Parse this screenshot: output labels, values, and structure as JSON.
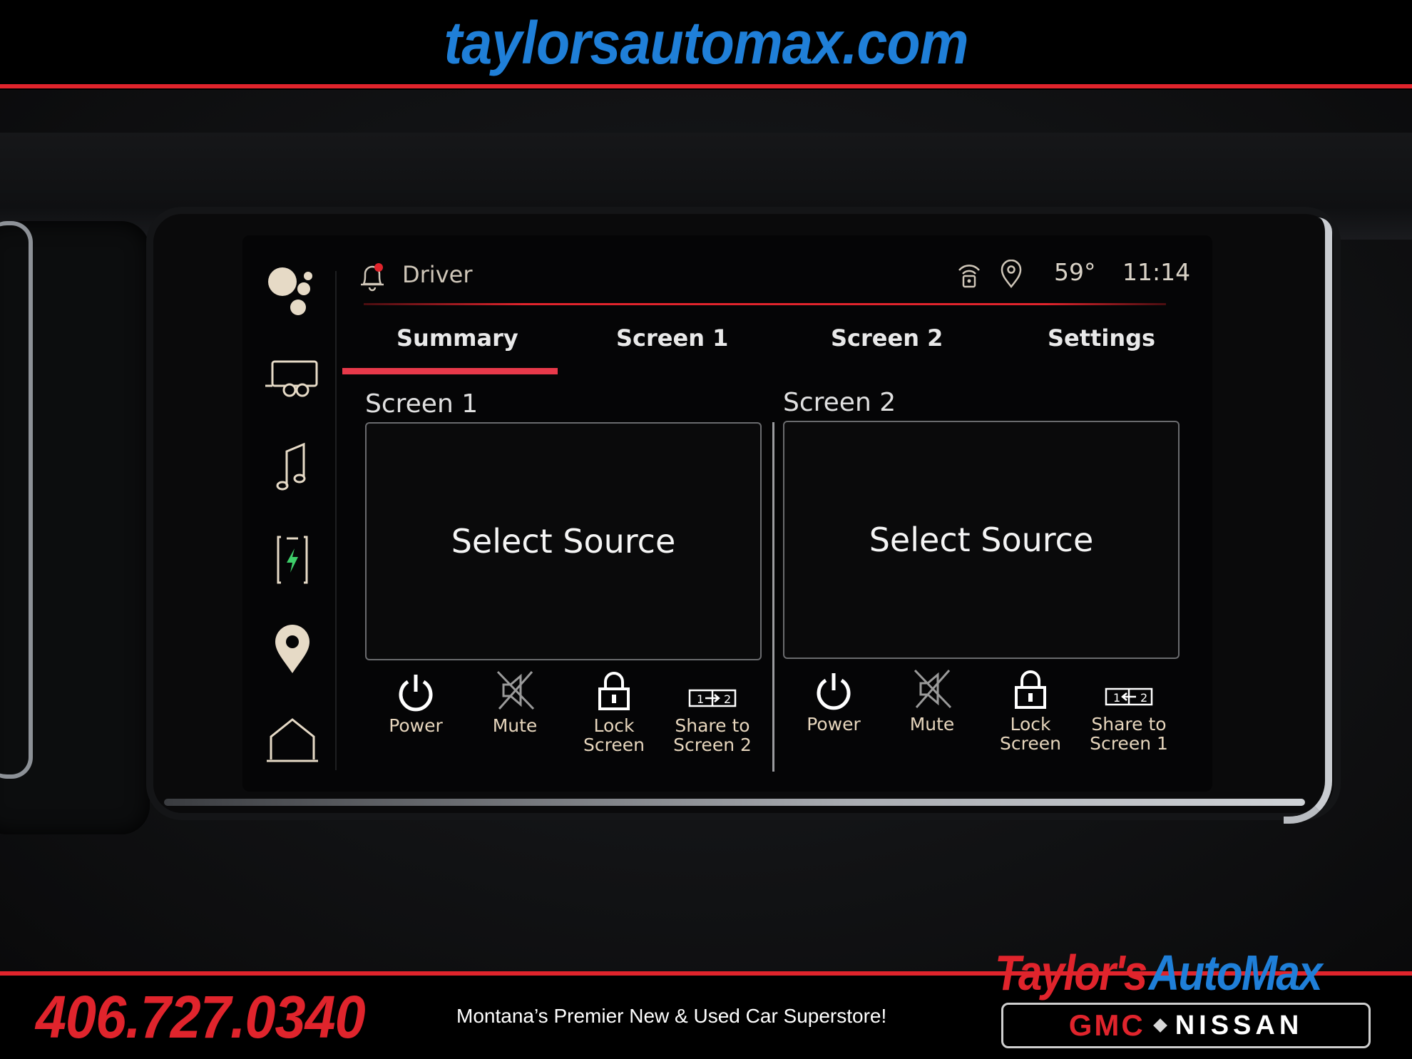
{
  "banner": {
    "site_url": "taylorsautomax.com",
    "phone": "406.727.0340",
    "tagline": "Montana’s Premier New & Used Car Superstore!",
    "brand_name_part1": "Taylor's",
    "brand_name_part2": "AutoMax",
    "logo_gmc": "GMC",
    "logo_nissan": "NISSAN"
  },
  "rail": {
    "icons": [
      "assistant-icon",
      "trailer-icon",
      "music-note-icon",
      "phone-charging-icon",
      "location-pin-icon",
      "home-icon"
    ]
  },
  "header": {
    "profile": "Driver",
    "temperature": "59°",
    "time": "11:14"
  },
  "tabs": [
    {
      "label": "Summary",
      "selected": true
    },
    {
      "label": "Screen 1",
      "selected": false
    },
    {
      "label": "Screen 2",
      "selected": false
    },
    {
      "label": "Settings",
      "selected": false
    }
  ],
  "screens": [
    {
      "title": "Screen 1",
      "source_prompt": "Select Source",
      "controls": {
        "power": "Power",
        "mute": "Mute",
        "lock_1": "Lock",
        "lock_2": "Screen",
        "share_1": "Share to",
        "share_2": "Screen 2"
      }
    },
    {
      "title": "Screen 2",
      "source_prompt": "Select Source",
      "controls": {
        "power": "Power",
        "mute": "Mute",
        "lock_1": "Lock",
        "lock_2": "Screen",
        "share_1": "Share to",
        "share_2": "Screen 1"
      }
    }
  ],
  "colors": {
    "accent_red": "#e0242c",
    "accent_blue": "#1f7fd8",
    "icon_cream": "#e6dac6"
  }
}
